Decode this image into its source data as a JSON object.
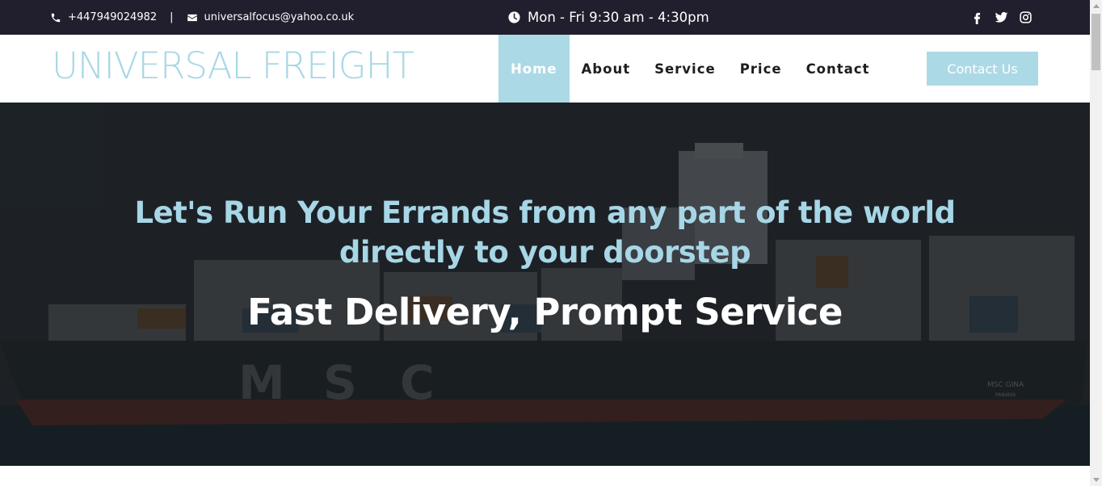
{
  "topbar": {
    "phone": "+447949024982",
    "separator": "|",
    "email": "universalfocus@yahoo.co.uk",
    "hours": "Mon - Fri 9:30 am - 4:30pm",
    "phone_icon": "phone-icon",
    "email_icon": "envelope-icon",
    "clock_icon": "clock-icon",
    "social": [
      "facebook-icon",
      "twitter-icon",
      "instagram-icon"
    ]
  },
  "header": {
    "logo": "UNIVERSAL FREIGHT",
    "nav": [
      {
        "label": "Home",
        "active": true
      },
      {
        "label": "About",
        "active": false
      },
      {
        "label": "Service",
        "active": false
      },
      {
        "label": "Price",
        "active": false
      },
      {
        "label": "Contact",
        "active": false
      }
    ],
    "cta_label": "Contact Us"
  },
  "hero": {
    "headline_line1": "Let's Run Your Errands from any part of the world",
    "headline_line2": "directly to your doorstep",
    "subheadline": "Fast Delivery, Prompt Service",
    "ship_text": "M S C",
    "ship_name": "MSC GINA",
    "ship_port": "PANAMA"
  },
  "colors": {
    "topbar_bg": "#211f2d",
    "accent": "#acd9e6",
    "headline": "#a7d6e6",
    "nav_text": "#1d1d1d"
  }
}
